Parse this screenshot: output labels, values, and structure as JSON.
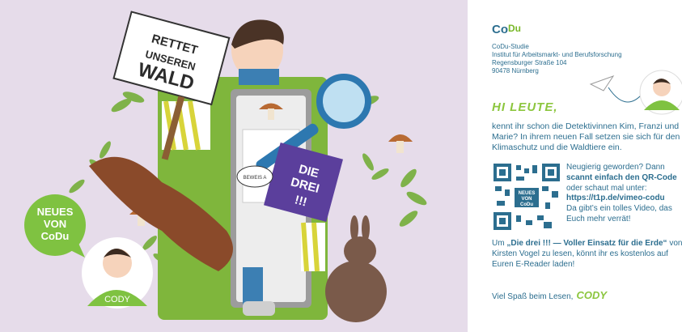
{
  "logo": {
    "co": "Co",
    "du": "Du"
  },
  "address": [
    "CoDu-Studie",
    "Institut für Arbeitsmarkt- und Berufsforschung",
    "Regensburger Straße 104",
    "90478 Nürnberg"
  ],
  "greeting": "HI LEUTE,",
  "intro": "kennt ihr schon die Detektivinnen Kim, Franzi und Marie? In ihrem neuen Fall setzen sie sich für den Klimaschutz und die Waldtiere ein.",
  "qr_block": {
    "line1": "Neugierig geworden? Dann",
    "strong1": "scannt einfach den QR-Code",
    "line2": "oder schaut mal unter:",
    "link": "https://t1p.de/vimeo-codu",
    "line3": "Da gibt’s ein tolles Video, das Euch mehr verrät!",
    "qr_badge": "NEUES VON CoDu"
  },
  "reading": {
    "prefix": "Um",
    "title": "„Die drei !!! — Voller Einsatz für die Erde“",
    "rest": "von Kirsten Vogel zu lesen, könnt ihr es kostenlos auf Euren E-Reader laden!"
  },
  "closing": {
    "text": "Viel Spaß beim Lesen,",
    "signature": "CODY"
  },
  "illustration": {
    "sign_lines": [
      "RETTET",
      "UNSEREN",
      "WALD"
    ],
    "book_title": [
      "DIE",
      "DREI",
      "!!!"
    ],
    "small_sign": "BEWEIS A",
    "news_bubble": [
      "NEUES",
      "VON",
      "CoDu"
    ],
    "shirt_label": "CODY"
  },
  "colors": {
    "art_bg": "#e6dcea",
    "text_blue": "#2c6e8f",
    "accent_green": "#8cc63e",
    "bubble_green": "#7fc241"
  }
}
